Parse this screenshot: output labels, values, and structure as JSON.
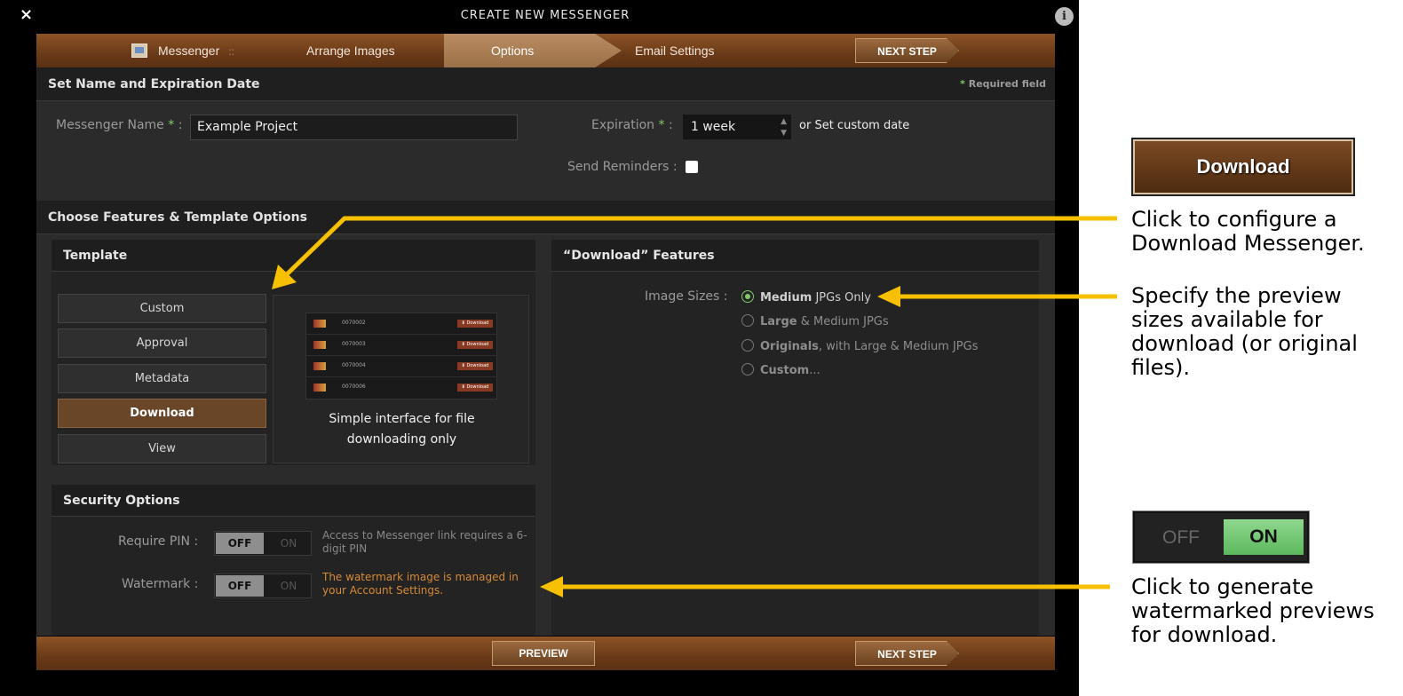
{
  "modal": {
    "title": "CREATE NEW MESSENGER",
    "close_label": "×",
    "info_label": "i"
  },
  "nav": {
    "items": [
      {
        "label": "Messenger",
        "sep": "::"
      },
      {
        "label": "Arrange Images"
      },
      {
        "label": "Options"
      },
      {
        "label": "Email Settings"
      }
    ],
    "active": "Options",
    "next_step": "NEXT STEP"
  },
  "name_section": {
    "title": "Set Name and Expiration Date",
    "required_note": "Required field",
    "required_mark": "*",
    "messenger_name_label": "Messenger Name",
    "messenger_name_value": "Example Project",
    "expiration_label": "Expiration",
    "expiration_value": "1 week",
    "or_text": "or",
    "custom_date": "Set custom date",
    "send_reminders_label": "Send Reminders :",
    "colon": ":"
  },
  "features_section": {
    "title": "Choose Features & Template Options",
    "template": {
      "title": "Template",
      "options": [
        "Custom",
        "Approval",
        "Metadata",
        "Download",
        "View"
      ],
      "selected": "Download",
      "preview_caption_line1": "Simple interface for file",
      "preview_caption_line2": "downloading only",
      "thumb_rows": [
        {
          "id": "0070002",
          "btn": "⬇ Download"
        },
        {
          "id": "0070003",
          "btn": "⬇ Download"
        },
        {
          "id": "0070004",
          "btn": "⬇ Download"
        },
        {
          "id": "0070006",
          "btn": "⬇ Download"
        }
      ]
    },
    "download_features": {
      "title": "“Download” Features",
      "image_sizes_label": "Image Sizes :",
      "options": [
        {
          "bold": "Medium",
          "rest": " JPGs Only",
          "selected": true
        },
        {
          "bold": "Large",
          "rest": " & Medium JPGs",
          "selected": false
        },
        {
          "bold": "Originals",
          "rest": ", with Large & Medium JPGs",
          "selected": false
        },
        {
          "bold": "Custom",
          "rest": "...",
          "selected": false
        }
      ]
    },
    "security": {
      "title": "Security Options",
      "require_pin_label": "Require PIN :",
      "require_pin_note": "Access to Messenger link requires a 6-digit PIN",
      "watermark_label": "Watermark :",
      "watermark_note": "The watermark image is managed in your Account Settings.",
      "off_label": "OFF",
      "on_label": "ON"
    }
  },
  "bottom": {
    "preview": "PREVIEW",
    "next_step": "NEXT STEP"
  },
  "annotations": {
    "download_button": "Download",
    "download_text": [
      "Click to configure a",
      "Download Messenger."
    ],
    "sizes_text": [
      "Specify the preview",
      "sizes available for",
      "download (or original",
      "files)."
    ],
    "toggle_off": "OFF",
    "toggle_on": "ON",
    "watermark_text": [
      "Click to generate",
      "watermarked previews",
      "for download."
    ],
    "arrow_color": "#f7c000"
  }
}
